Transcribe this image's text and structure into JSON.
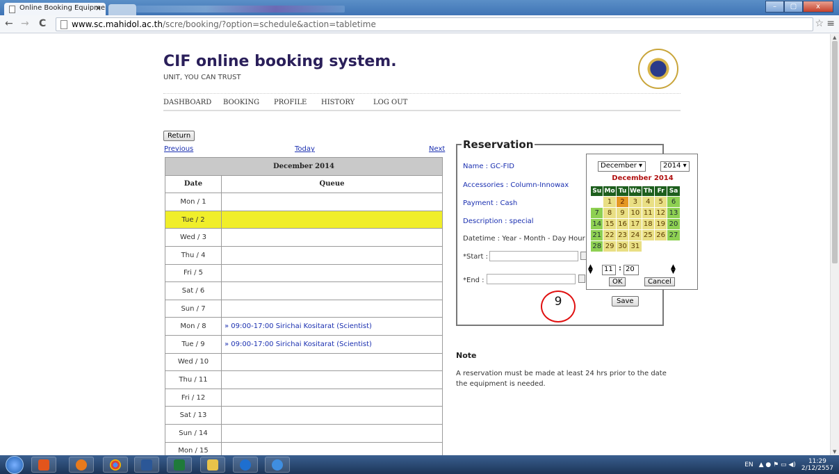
{
  "browser": {
    "tab_title": "Online Booking Equipmen",
    "tab_close": "×",
    "url_host": "www.sc.mahidol.ac.th",
    "url_path": "/scre/booking/?option=schedule&action=tabletime",
    "back": "←",
    "forward": "→",
    "reload": "C",
    "star": "☆",
    "menu": "≡",
    "window_buttons": [
      "–",
      "▢",
      "x"
    ]
  },
  "site": {
    "title": "CIF online booking system.",
    "tagline": "UNIT, YOU CAN TRUST",
    "nav": [
      "DASHBOARD",
      "BOOKING",
      "PROFILE",
      "HISTORY",
      "LOG OUT"
    ]
  },
  "schedule": {
    "return_label": "Return",
    "previous_label": "Previous",
    "today_label": "Today",
    "next_label": "Next",
    "month": "December 2014",
    "col_date": "Date",
    "col_queue": "Queue",
    "rows": [
      {
        "date": "Mon / 1",
        "queue": ""
      },
      {
        "date": "Tue / 2",
        "queue": ""
      },
      {
        "date": "Wed / 3",
        "queue": ""
      },
      {
        "date": "Thu / 4",
        "queue": ""
      },
      {
        "date": "Fri / 5",
        "queue": ""
      },
      {
        "date": "Sat / 6",
        "queue": ""
      },
      {
        "date": "Sun / 7",
        "queue": ""
      },
      {
        "date": "Mon / 8",
        "queue": "» 09:00-17:00 Sirichai Kositarat (Scientist)"
      },
      {
        "date": "Tue / 9",
        "queue": "» 09:00-17:00 Sirichai Kositarat (Scientist)"
      },
      {
        "date": "Wed / 10",
        "queue": ""
      },
      {
        "date": "Thu / 11",
        "queue": ""
      },
      {
        "date": "Fri / 12",
        "queue": ""
      },
      {
        "date": "Sat / 13",
        "queue": ""
      },
      {
        "date": "Sun / 14",
        "queue": ""
      },
      {
        "date": "Mon / 15",
        "queue": ""
      }
    ],
    "highlight_color": "#f0ee2a"
  },
  "reservation": {
    "legend": "Reservation",
    "name": "Name : GC-FID",
    "accessories": "Accessories : Column-Innowax",
    "payment": "Payment : Cash",
    "description": "Description : special",
    "datetime": "Datetime : Year - Month - Day  Hour : M",
    "start_label": "*Start :",
    "end_label": "*End :",
    "save_label": "Save",
    "annotation": "9"
  },
  "calendar": {
    "month_select": "December ▾",
    "year_select": "2014 ▾",
    "title": "December 2014",
    "weekdays": [
      "Su",
      "Mo",
      "Tu",
      "We",
      "Th",
      "Fr",
      "Sa"
    ],
    "weeks": [
      [
        "",
        "1",
        "2",
        "3",
        "4",
        "5",
        "6"
      ],
      [
        "7",
        "8",
        "9",
        "10",
        "11",
        "12",
        "13"
      ],
      [
        "14",
        "15",
        "16",
        "17",
        "18",
        "19",
        "20"
      ],
      [
        "21",
        "22",
        "23",
        "24",
        "25",
        "26",
        "27"
      ],
      [
        "28",
        "29",
        "30",
        "31",
        "",
        "",
        ""
      ]
    ],
    "selected_day": "2",
    "hour": "11",
    "minute": "20",
    "separator": ":",
    "ok_label": "OK",
    "cancel_label": "Cancel"
  },
  "note": {
    "heading": "Note",
    "text": "A reservation must be made at least 24 hrs prior to the date the equipment is needed."
  },
  "taskbar": {
    "lang": "EN",
    "time": "11:29",
    "date": "2/12/2557"
  }
}
